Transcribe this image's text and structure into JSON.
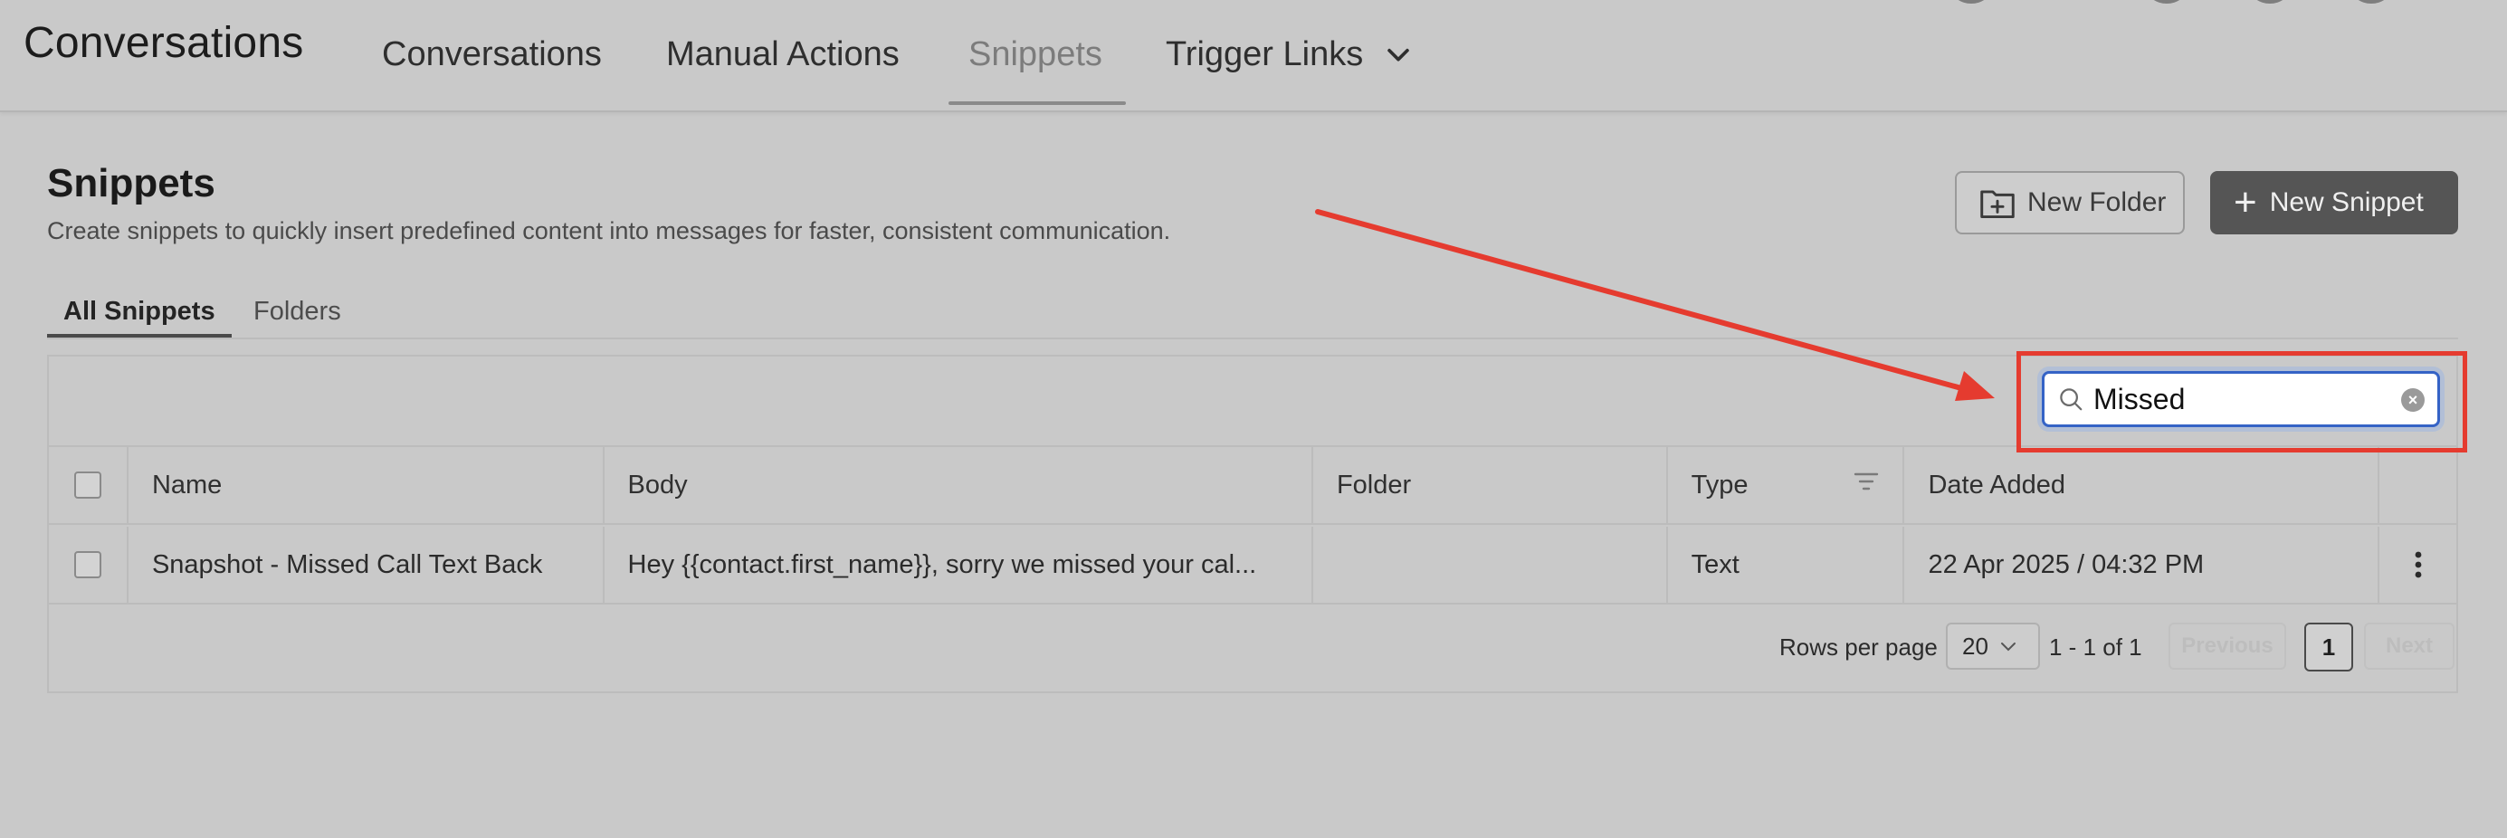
{
  "header": {
    "app_title": "Conversations",
    "nav_tabs": [
      {
        "label": "Conversations",
        "active": false
      },
      {
        "label": "Manual Actions",
        "active": false
      },
      {
        "label": "Snippets",
        "active": true
      },
      {
        "label": "Trigger Links",
        "active": false,
        "has_dropdown": true
      }
    ]
  },
  "page": {
    "title": "Snippets",
    "description": "Create snippets to quickly insert predefined content into messages for faster, consistent communication.",
    "new_folder_label": "New Folder",
    "new_snippet_label": "New Snippet"
  },
  "subtabs": [
    {
      "label": "All Snippets",
      "active": true
    },
    {
      "label": "Folders",
      "active": false
    }
  ],
  "search": {
    "value": "Missed"
  },
  "table": {
    "columns": [
      "Name",
      "Body",
      "Folder",
      "Type",
      "Date Added"
    ],
    "rows": [
      {
        "name": "Snapshot - Missed Call Text Back",
        "body": "Hey {{contact.first_name}}, sorry we missed your cal...",
        "folder": "",
        "type": "Text",
        "date_added": "22 Apr 2025 / 04:32 PM"
      }
    ]
  },
  "pagination": {
    "rows_per_page_label": "Rows per page",
    "rows_per_page_value": "20",
    "range": "1 - 1 of 1",
    "previous_label": "Previous",
    "next_label": "Next",
    "current_page": "1"
  },
  "colors": {
    "annotation_red": "#e53b2f",
    "focus_blue": "#3563c6",
    "primary_button": "#555555",
    "background": "#c9c9c9"
  }
}
